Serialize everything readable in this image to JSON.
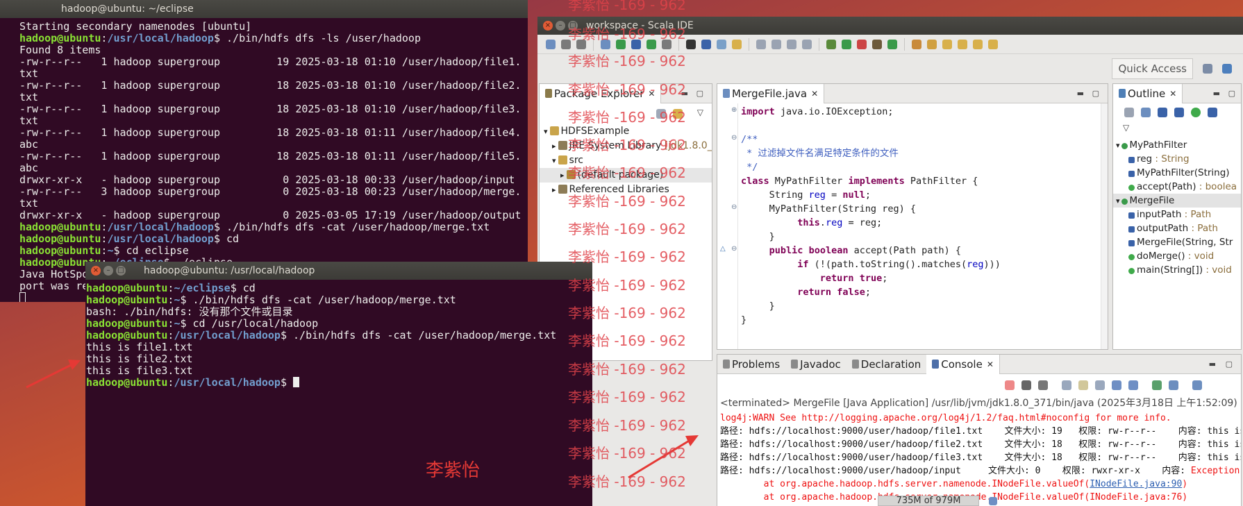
{
  "terminal1": {
    "title": "hadoop@ubuntu: ~/eclipse",
    "lines": [
      [
        {
          "t": "Starting secondary namenodes [ubuntu]"
        }
      ],
      [
        {
          "t": "hadoop@ubuntu",
          "c": "user"
        },
        {
          "t": ":"
        },
        {
          "t": "/usr/local/hadoop",
          "c": "path"
        },
        {
          "t": "$ ./bin/hdfs dfs -ls /user/hadoop"
        }
      ],
      [
        {
          "t": "Found 8 items"
        }
      ],
      [
        {
          "t": "-rw-r--r--   1 hadoop supergroup         19 2025-03-18 01:10 /user/hadoop/file1."
        }
      ],
      [
        {
          "t": "txt"
        }
      ],
      [
        {
          "t": "-rw-r--r--   1 hadoop supergroup         18 2025-03-18 01:10 /user/hadoop/file2."
        }
      ],
      [
        {
          "t": "txt"
        }
      ],
      [
        {
          "t": "-rw-r--r--   1 hadoop supergroup         18 2025-03-18 01:10 /user/hadoop/file3."
        }
      ],
      [
        {
          "t": "txt"
        }
      ],
      [
        {
          "t": "-rw-r--r--   1 hadoop supergroup         18 2025-03-18 01:11 /user/hadoop/file4."
        }
      ],
      [
        {
          "t": "abc"
        }
      ],
      [
        {
          "t": "-rw-r--r--   1 hadoop supergroup         18 2025-03-18 01:11 /user/hadoop/file5."
        }
      ],
      [
        {
          "t": "abc"
        }
      ],
      [
        {
          "t": "drwxr-xr-x   - hadoop supergroup          0 2025-03-18 00:33 /user/hadoop/input"
        }
      ],
      [
        {
          "t": "-rw-r--r--   3 hadoop supergroup          0 2025-03-18 00:23 /user/hadoop/merge."
        }
      ],
      [
        {
          "t": "txt"
        }
      ],
      [
        {
          "t": "drwxr-xr-x   - hadoop supergroup          0 2025-03-05 17:19 /user/hadoop/output"
        }
      ],
      [
        {
          "t": "hadoop@ubuntu",
          "c": "user"
        },
        {
          "t": ":"
        },
        {
          "t": "/usr/local/hadoop",
          "c": "path"
        },
        {
          "t": "$ ./bin/hdfs dfs -cat /user/hadoop/merge.txt"
        }
      ],
      [
        {
          "t": "hadoop@ubuntu",
          "c": "user"
        },
        {
          "t": ":"
        },
        {
          "t": "/usr/local/hadoop",
          "c": "path"
        },
        {
          "t": "$ cd"
        }
      ],
      [
        {
          "t": "hadoop@ubuntu",
          "c": "user"
        },
        {
          "t": ":"
        },
        {
          "t": "~",
          "c": "path"
        },
        {
          "t": "$ cd eclipse"
        }
      ],
      [
        {
          "t": "hadoop@ubuntu",
          "c": "user"
        },
        {
          "t": ":"
        },
        {
          "t": "~/eclipse",
          "c": "path"
        },
        {
          "t": "$ ./eclipse"
        }
      ],
      [
        {
          "t": "Java HotSpo"
        }
      ],
      [
        {
          "t": "port was re"
        }
      ],
      [
        {
          "t": "",
          "c": "cursor-hollow"
        }
      ]
    ]
  },
  "terminal2": {
    "title": "hadoop@ubuntu: /usr/local/hadoop",
    "lines": [
      [
        {
          "t": "hadoop@ubuntu",
          "c": "user"
        },
        {
          "t": ":"
        },
        {
          "t": "~/eclipse",
          "c": "path"
        },
        {
          "t": "$ cd"
        }
      ],
      [
        {
          "t": "hadoop@ubuntu",
          "c": "user"
        },
        {
          "t": ":"
        },
        {
          "t": "~",
          "c": "path"
        },
        {
          "t": "$ ./bin/hdfs dfs -cat /user/hadoop/merge.txt"
        }
      ],
      [
        {
          "t": "bash: ./bin/hdfs: 没有那个文件或目录"
        }
      ],
      [
        {
          "t": "hadoop@ubuntu",
          "c": "user"
        },
        {
          "t": ":"
        },
        {
          "t": "~",
          "c": "path"
        },
        {
          "t": "$ cd /usr/local/hadoop"
        }
      ],
      [
        {
          "t": "hadoop@ubuntu",
          "c": "user"
        },
        {
          "t": ":"
        },
        {
          "t": "/usr/local/hadoop",
          "c": "path"
        },
        {
          "t": "$ ./bin/hdfs dfs -cat /user/hadoop/merge.txt"
        }
      ],
      [
        {
          "t": "this is file1.txt"
        }
      ],
      [
        {
          "t": "this is file2.txt"
        }
      ],
      [
        {
          "t": "this is file3.txt"
        }
      ],
      [
        {
          "t": "hadoop@ubuntu",
          "c": "user"
        },
        {
          "t": ":"
        },
        {
          "t": "/usr/local/hadoop",
          "c": "path"
        },
        {
          "t": "$ "
        },
        {
          "t": "",
          "c": "cursor"
        }
      ]
    ],
    "author_label": "李紫怡"
  },
  "ide": {
    "title": "workspace - Scala IDE",
    "quick_access": "Quick Access",
    "package_explorer": {
      "tab_label": "Package Explorer",
      "tree": [
        {
          "label": "HDFSExample",
          "arrow": "▾",
          "indent": 0,
          "icon": "project"
        },
        {
          "label": "JRE System Library",
          "suffix": "[jdk1.8.0_37",
          "arrow": "▸",
          "indent": 1,
          "icon": "lib"
        },
        {
          "label": "src",
          "arrow": "▾",
          "indent": 1,
          "icon": "folder"
        },
        {
          "label": "(default package)",
          "arrow": "▸",
          "indent": 2,
          "icon": "package",
          "selected": true
        },
        {
          "label": "Referenced Libraries",
          "arrow": "▸",
          "indent": 1,
          "icon": "lib"
        }
      ]
    },
    "editor": {
      "tab_label": "MergeFile.java",
      "lines": [
        [
          {
            "t": "import",
            "c": "kw"
          },
          {
            "t": " java.io.IOException;"
          }
        ],
        [
          {
            "t": ""
          }
        ],
        [
          {
            "t": "/**",
            "c": "cmt"
          }
        ],
        [
          {
            "t": " * 过滤掉文件名满足特定条件的文件",
            "c": "cmt"
          }
        ],
        [
          {
            "t": " */",
            "c": "cmt"
          }
        ],
        [
          {
            "t": "class",
            "c": "kw"
          },
          {
            "t": " MyPathFilter "
          },
          {
            "t": "implements",
            "c": "kw"
          },
          {
            "t": " PathFilter {"
          }
        ],
        [
          {
            "t": "     String "
          },
          {
            "t": "reg",
            "c": "fld"
          },
          {
            "t": " = "
          },
          {
            "t": "null",
            "c": "kw"
          },
          {
            "t": ";"
          }
        ],
        [
          {
            "t": "     MyPathFilter(String reg) {"
          }
        ],
        [
          {
            "t": "          "
          },
          {
            "t": "this",
            "c": "kw"
          },
          {
            "t": "."
          },
          {
            "t": "reg",
            "c": "fld"
          },
          {
            "t": " = reg;"
          }
        ],
        [
          {
            "t": "     }"
          }
        ],
        [
          {
            "t": "     "
          },
          {
            "t": "public",
            "c": "kw"
          },
          {
            "t": " "
          },
          {
            "t": "boolean",
            "c": "kw"
          },
          {
            "t": " accept(Path path) {"
          }
        ],
        [
          {
            "t": "          "
          },
          {
            "t": "if",
            "c": "kw"
          },
          {
            "t": " (!(path.toString().matches("
          },
          {
            "t": "reg",
            "c": "fld"
          },
          {
            "t": ")))"
          }
        ],
        [
          {
            "t": "              "
          },
          {
            "t": "return",
            "c": "kw"
          },
          {
            "t": " "
          },
          {
            "t": "true",
            "c": "kw"
          },
          {
            "t": ";"
          }
        ],
        [
          {
            "t": "          "
          },
          {
            "t": "return",
            "c": "kw"
          },
          {
            "t": " "
          },
          {
            "t": "false",
            "c": "kw"
          },
          {
            "t": ";"
          }
        ],
        [
          {
            "t": "     }"
          }
        ],
        [
          {
            "t": "}"
          }
        ]
      ]
    },
    "outline": {
      "tab_label": "Outline",
      "items": [
        {
          "label": "MyPathFilter",
          "indent": 0,
          "icon": "class"
        },
        {
          "label": "reg",
          "type": " : String",
          "indent": 1,
          "icon": "field"
        },
        {
          "label": "MyPathFilter(String)",
          "type": "",
          "indent": 1,
          "icon": "ctor"
        },
        {
          "label": "accept(Path)",
          "type": " : boolea",
          "indent": 1,
          "icon": "method"
        },
        {
          "label": "MergeFile",
          "indent": 0,
          "icon": "class",
          "selected": true
        },
        {
          "label": "inputPath",
          "type": " : Path",
          "indent": 1,
          "icon": "field"
        },
        {
          "label": "outputPath",
          "type": " : Path",
          "indent": 1,
          "icon": "field"
        },
        {
          "label": "MergeFile(String, Str",
          "type": "",
          "indent": 1,
          "icon": "ctor"
        },
        {
          "label": "doMerge()",
          "type": " : void",
          "indent": 1,
          "icon": "method"
        },
        {
          "label": "main(String[])",
          "type": " : void",
          "indent": 1,
          "icon": "method"
        }
      ]
    },
    "console": {
      "tabs": [
        "Problems",
        "Javadoc",
        "Declaration",
        "Console"
      ],
      "terminated": "<terminated> MergeFile [Java Application] /usr/lib/jvm/jdk1.8.0_371/bin/java (2025年3月18日 上午1:52:09)",
      "lines": [
        [
          {
            "t": "log4j:WARN See http://logging.apache.org/log4j/1.2/faq.html#noconfig for more info.",
            "c": "red"
          }
        ],
        [
          {
            "t": "路径: hdfs://localhost:9000/user/hadoop/file1.txt    文件大小: 19   权限: rw-r--r--    内容: this is"
          }
        ],
        [
          {
            "t": "路径: hdfs://localhost:9000/user/hadoop/file2.txt    文件大小: 18   权限: rw-r--r--    内容: this is"
          }
        ],
        [
          {
            "t": "路径: hdfs://localhost:9000/user/hadoop/file3.txt    文件大小: 18   权限: rw-r--r--    内容: this is"
          }
        ],
        [
          {
            "t": "路径: hdfs://localhost:9000/user/hadoop/input     文件大小: 0    权限: rwxr-xr-x    内容: "
          },
          {
            "t": "Exception in",
            "c": "red"
          }
        ],
        [
          {
            "t": "        at org.apache.hadoop.hdfs.server.namenode.INodeFile.valueOf(",
            "c": "red"
          },
          {
            "t": "INodeFile.java:90",
            "c": "link"
          },
          {
            "t": ")",
            "c": "red"
          }
        ],
        [
          {
            "t": "        at org.apache.hadoop.hdfs.server.namenode.INodeFile.valueOf(INodeFile.java:76)",
            "c": "red"
          }
        ]
      ]
    },
    "heap_status": "735M of 979M"
  },
  "watermark": "李紫怡 -169 - 962"
}
